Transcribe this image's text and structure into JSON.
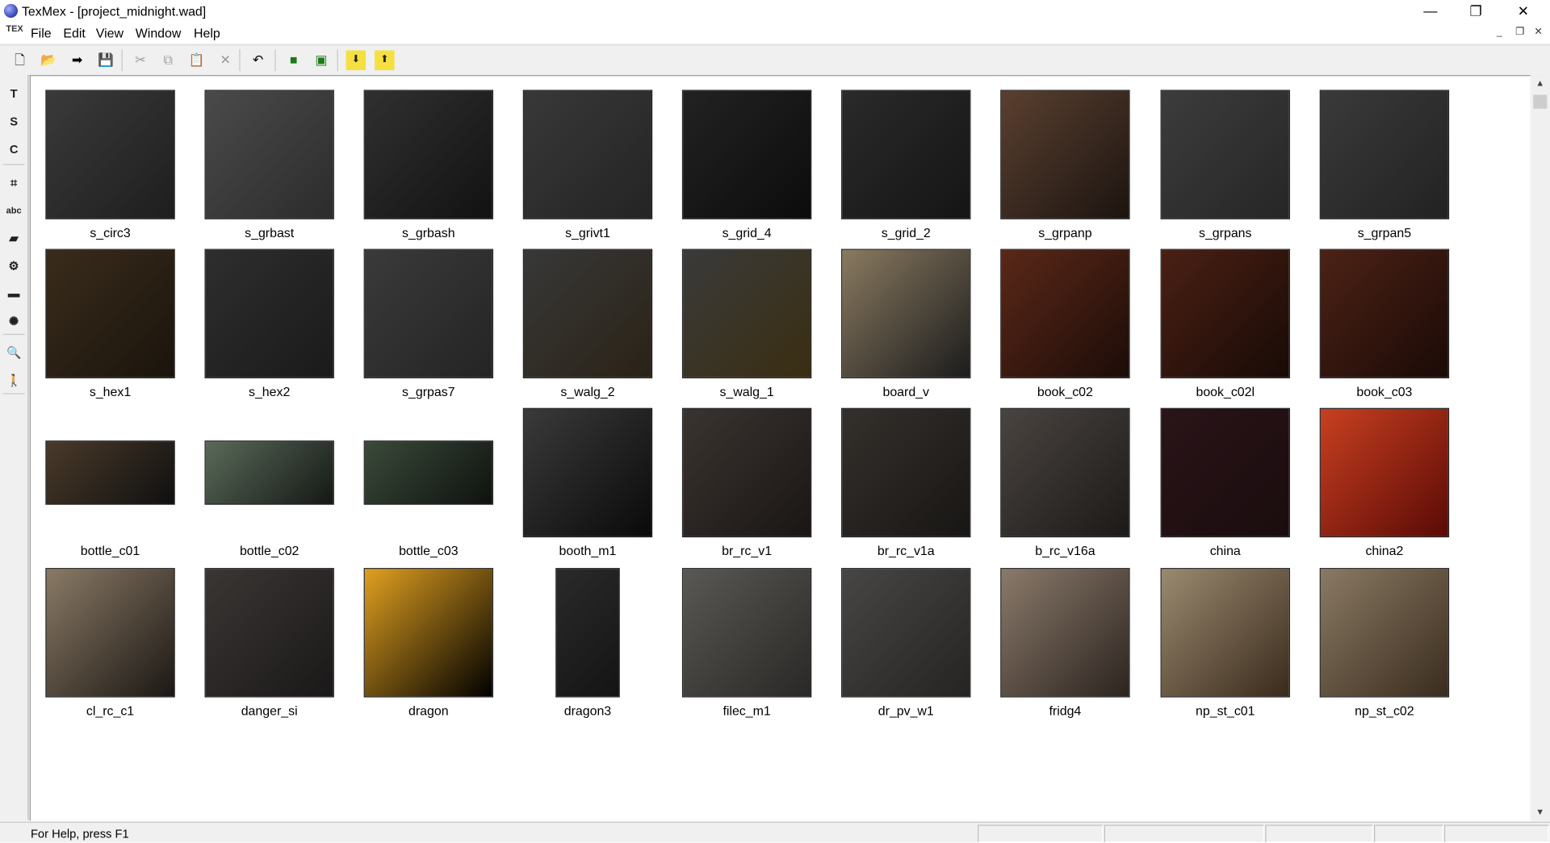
{
  "window": {
    "title": "TexMex - [project_midnight.wad]",
    "minimize": "—",
    "maximize": "❐",
    "close": "✕"
  },
  "menu": {
    "logo": "TEX",
    "items": [
      "File",
      "Edit",
      "View",
      "Window",
      "Help"
    ],
    "mdi": {
      "minimize": "_",
      "restore": "❐",
      "close": "✕"
    }
  },
  "toolbar": {
    "buttons": [
      {
        "icon": "new-file-icon",
        "glyph": "🗋"
      },
      {
        "icon": "open-folder-icon",
        "glyph": "📂"
      },
      {
        "icon": "arrow-right-icon",
        "glyph": "➡"
      },
      {
        "icon": "save-icon",
        "glyph": "💾"
      },
      {
        "icon": "cut-icon",
        "glyph": "✂"
      },
      {
        "icon": "copy-icon",
        "glyph": "⧉"
      },
      {
        "icon": "paste-icon",
        "glyph": "📋"
      },
      {
        "icon": "delete-icon",
        "glyph": "✕"
      },
      {
        "icon": "undo-icon",
        "glyph": "↶"
      },
      {
        "icon": "view-single-icon",
        "glyph": "■"
      },
      {
        "icon": "view-fit-icon",
        "glyph": "▣"
      },
      {
        "icon": "import-icon",
        "glyph": "⬇"
      },
      {
        "icon": "export-icon",
        "glyph": "⬆"
      }
    ]
  },
  "left_tools": [
    {
      "icon": "t-tool-icon",
      "glyph": "T"
    },
    {
      "icon": "s-tool-icon",
      "glyph": "S"
    },
    {
      "icon": "c-tool-icon",
      "glyph": "C"
    },
    {
      "icon": "crop-icon",
      "glyph": "⌗"
    },
    {
      "icon": "text-abc-icon",
      "glyph": "abc"
    },
    {
      "icon": "speech-bubble-icon",
      "glyph": "▰"
    },
    {
      "icon": "gear-icon",
      "glyph": "⚙"
    },
    {
      "icon": "truck-icon",
      "glyph": "▬"
    },
    {
      "icon": "sun-icon",
      "glyph": "✺"
    },
    {
      "icon": "zoom-icon",
      "glyph": "🔍"
    },
    {
      "icon": "walking-figure-icon",
      "glyph": "🚶"
    }
  ],
  "textures": [
    {
      "name": "s_circ3",
      "shape": "sq",
      "colors": [
        "#3a3a3a",
        "#1e1e1e"
      ]
    },
    {
      "name": "s_grbast",
      "shape": "sq",
      "colors": [
        "#4a4a4a",
        "#2c2c2c"
      ]
    },
    {
      "name": "s_grbash",
      "shape": "sq",
      "colors": [
        "#303030",
        "#121212"
      ]
    },
    {
      "name": "s_grivt1",
      "shape": "sq",
      "colors": [
        "#383838",
        "#242424"
      ]
    },
    {
      "name": "s_grid_4",
      "shape": "sq",
      "colors": [
        "#222222",
        "#0c0c0c"
      ]
    },
    {
      "name": "s_grid_2",
      "shape": "sq",
      "colors": [
        "#2a2a2a",
        "#151515"
      ]
    },
    {
      "name": "s_grpanp",
      "shape": "sq",
      "colors": [
        "#5a4030",
        "#1c1410"
      ]
    },
    {
      "name": "s_grpans",
      "shape": "sq",
      "colors": [
        "#3c3c3c",
        "#262626"
      ]
    },
    {
      "name": "s_grpan5",
      "shape": "sq",
      "colors": [
        "#3a3a3a",
        "#222222"
      ]
    },
    {
      "name": "s_hex1",
      "shape": "sq",
      "colors": [
        "#3a2c1c",
        "#1a140c"
      ]
    },
    {
      "name": "s_hex2",
      "shape": "sq",
      "colors": [
        "#2e2e2e",
        "#1a1a1a"
      ]
    },
    {
      "name": "s_grpas7",
      "shape": "sq",
      "colors": [
        "#3a3a3a",
        "#242424"
      ]
    },
    {
      "name": "s_walg_2",
      "shape": "sq",
      "colors": [
        "#383838",
        "#2a2216"
      ]
    },
    {
      "name": "s_walg_1",
      "shape": "sq",
      "colors": [
        "#3a3a3a",
        "#3a2e12"
      ]
    },
    {
      "name": "board_v",
      "shape": "sq",
      "colors": [
        "#8a7a60",
        "#1c1c1c"
      ]
    },
    {
      "name": "book_c02",
      "shape": "sq",
      "colors": [
        "#5a2818",
        "#1c0c08"
      ]
    },
    {
      "name": "book_c02l",
      "shape": "sq",
      "colors": [
        "#4a2014",
        "#180a06"
      ]
    },
    {
      "name": "book_c03",
      "shape": "sq",
      "colors": [
        "#4c2216",
        "#1a0a06"
      ]
    },
    {
      "name": "bottle_c01",
      "shape": "wide",
      "colors": [
        "#4a3a2a",
        "#101010"
      ]
    },
    {
      "name": "bottle_c02",
      "shape": "wide",
      "colors": [
        "#5a6a5a",
        "#141814"
      ]
    },
    {
      "name": "bottle_c03",
      "shape": "wide",
      "colors": [
        "#3a4a3a",
        "#0e120e"
      ]
    },
    {
      "name": "booth_m1",
      "shape": "sq",
      "colors": [
        "#3a3a3a",
        "#0a0a0a"
      ]
    },
    {
      "name": "br_rc_v1",
      "shape": "sq",
      "colors": [
        "#3a3430",
        "#1a1614"
      ]
    },
    {
      "name": "br_rc_v1a",
      "shape": "sq",
      "colors": [
        "#34302c",
        "#181614"
      ]
    },
    {
      "name": "b_rc_v16a",
      "shape": "sq",
      "colors": [
        "#4a4440",
        "#1c1a18"
      ]
    },
    {
      "name": "china",
      "shape": "sq",
      "colors": [
        "#2a1418",
        "#1a0c0e"
      ]
    },
    {
      "name": "china2",
      "shape": "sq",
      "colors": [
        "#c84020",
        "#5a0a06"
      ]
    },
    {
      "name": "cl_rc_c1",
      "shape": "sq",
      "colors": [
        "#8a7a66",
        "#1c1814"
      ]
    },
    {
      "name": "danger_si",
      "shape": "sq",
      "colors": [
        "#3a3634",
        "#1a1818"
      ]
    },
    {
      "name": "dragon",
      "shape": "sq",
      "colors": [
        "#e0a020",
        "#000000"
      ]
    },
    {
      "name": "dragon3",
      "shape": "tall",
      "colors": [
        "#2a2a2a",
        "#141414"
      ]
    },
    {
      "name": "filec_m1",
      "shape": "sq",
      "colors": [
        "#5a5854",
        "#2a2826"
      ]
    },
    {
      "name": "dr_pv_w1",
      "shape": "sq",
      "colors": [
        "#484644",
        "#262422"
      ]
    },
    {
      "name": "fridg4",
      "shape": "sq",
      "colors": [
        "#8a7a6a",
        "#2c2420"
      ]
    },
    {
      "name": "np_st_c01",
      "shape": "sq",
      "colors": [
        "#9a8a70",
        "#3a2a1c"
      ]
    },
    {
      "name": "np_st_c02",
      "shape": "sq",
      "colors": [
        "#8a7a64",
        "#3a2c1e"
      ]
    }
  ],
  "status": {
    "help_text": "For Help, press F1"
  }
}
